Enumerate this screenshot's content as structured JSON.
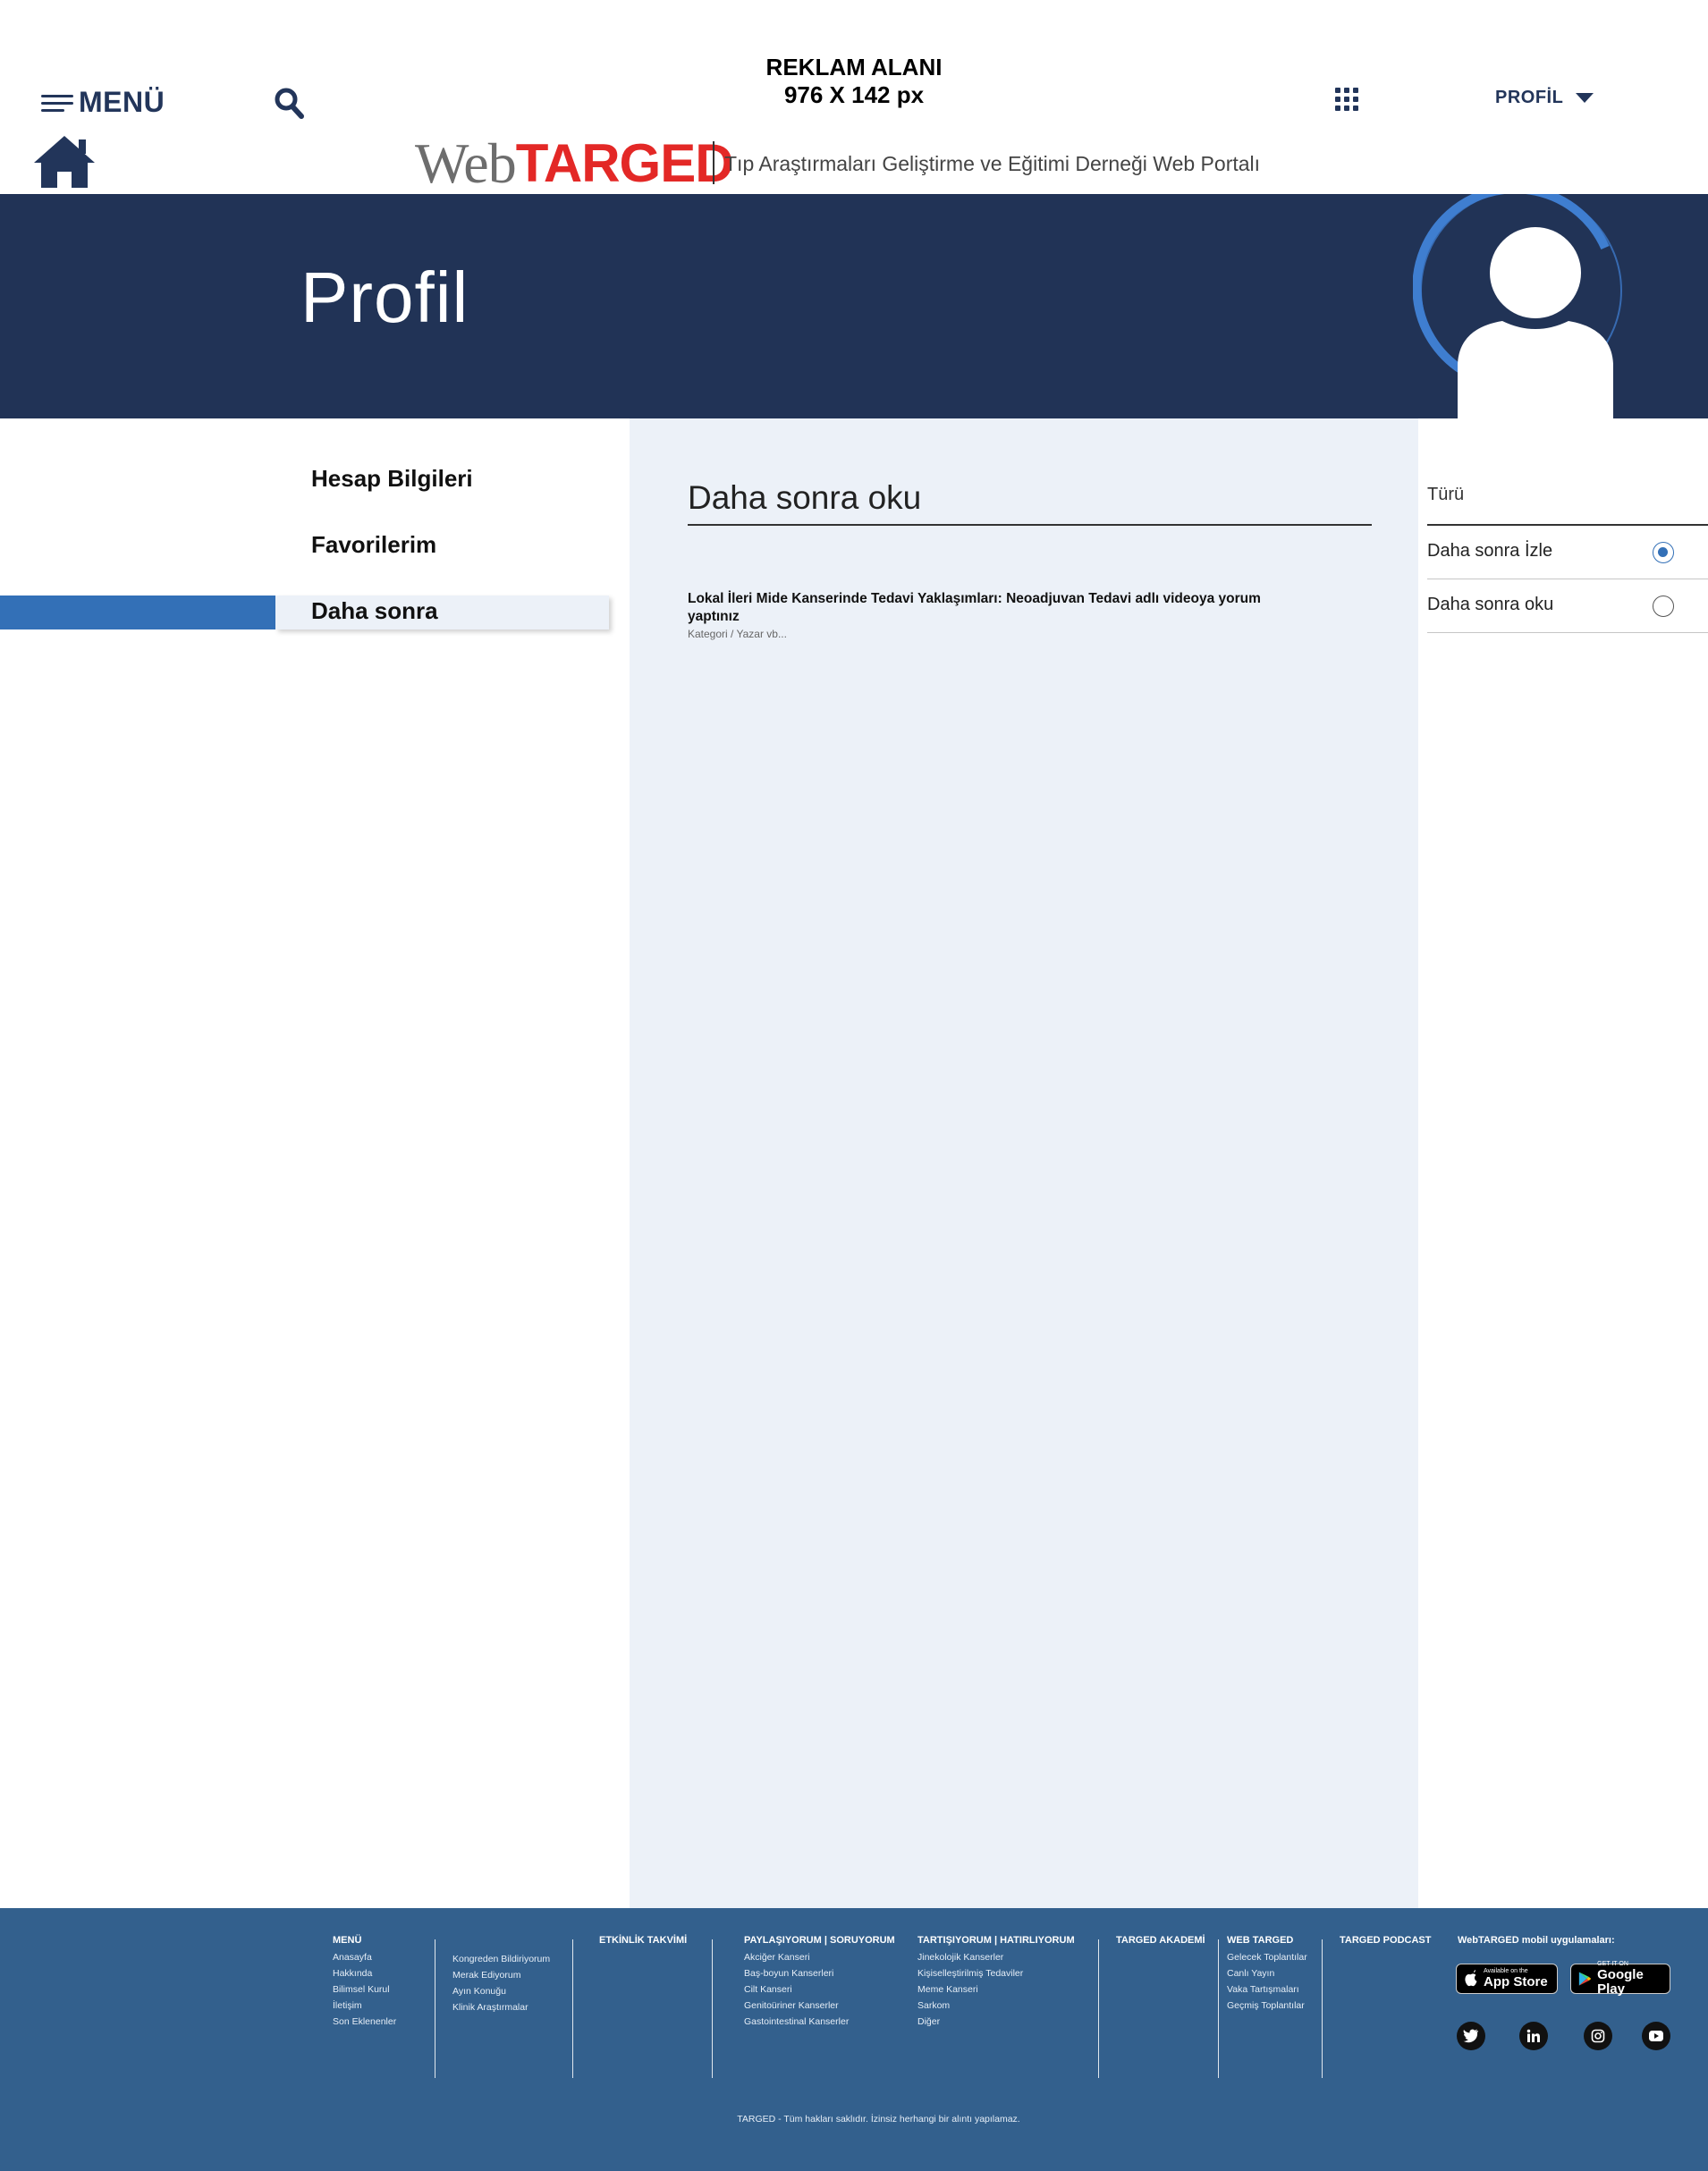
{
  "header": {
    "menu_label": "MENÜ",
    "ad_line1": "REKLAM ALANI",
    "ad_line2": "976 X 142 px",
    "profile_label": "PROFİL",
    "logo_web": "Web",
    "logo_targed": "TARGED",
    "tagline": "Tıp Araştırmaları Geliştirme ve Eğitimi Derneği Web Portalı"
  },
  "banner": {
    "title": "Profil"
  },
  "sidebar": {
    "items": [
      {
        "label": "Hesap Bilgileri"
      },
      {
        "label": "Favorilerim"
      },
      {
        "label": "Daha sonra",
        "active": true
      }
    ]
  },
  "main": {
    "title": "Daha sonra oku",
    "items": [
      {
        "title": "Lokal İleri Mide Kanserinde Tedavi Yaklaşımları: Neoadjuvan Tedavi adlı videoya yorum yaptınız",
        "meta": "Kategori / Yazar vb..."
      }
    ]
  },
  "filter": {
    "heading": "Türü",
    "options": [
      {
        "label": "Daha sonra İzle",
        "selected": true
      },
      {
        "label": "Daha sonra oku",
        "selected": false
      }
    ]
  },
  "footer": {
    "menu": {
      "heading": "MENÜ",
      "links": [
        "Anasayfa",
        "Hakkında",
        "Bilimsel Kurul",
        "İletişim",
        "Son Eklenenler"
      ]
    },
    "menu2": {
      "links": [
        "Kongreden Bildiriyorum",
        "Merak Ediyorum",
        "Ayın Konuğu",
        "Klinik Araştırmalar"
      ]
    },
    "events": {
      "heading": "ETKİNLİK TAKVİMİ"
    },
    "share": {
      "heading": "PAYLAŞIYORUM   |   SORUYORUM",
      "links": [
        "Akciğer Kanseri",
        "Baş-boyun Kanserleri",
        "Cilt Kanseri",
        "Genitoüriner Kanserler",
        "Gastointestinal Kanserler"
      ]
    },
    "discuss": {
      "heading": "TARTIŞIYORUM   |   HATIRLIYORUM",
      "links": [
        "Jinekolojik Kanserler",
        "Kişiselleştirilmiş Tedaviler",
        "Meme Kanseri",
        "Sarkom",
        "Diğer"
      ]
    },
    "academy": {
      "heading": "TARGED AKADEMİ"
    },
    "webtarged": {
      "heading": "WEB TARGED",
      "links": [
        "Gelecek Toplantılar",
        "Canlı Yayın",
        "Vaka Tartışmaları",
        "Geçmiş Toplantılar"
      ]
    },
    "podcast": {
      "heading": "TARGED PODCAST"
    },
    "apps": {
      "heading": "WebTARGED mobil uygulamaları:",
      "appstore_small": "Available on the",
      "appstore_big": "App Store",
      "googleplay_small": "GET IT ON",
      "googleplay_big": "Google Play"
    },
    "social_icons": [
      "twitter-icon",
      "linkedin-icon",
      "instagram-icon",
      "youtube-icon"
    ],
    "copyright": "TARGED - Tüm hakları saklıdır. İzinsiz herhangi bir alıntı yapılamaz."
  },
  "colors": {
    "navy": "#213356",
    "accent_blue": "#3370b7",
    "panel_bg": "#ecf1f8",
    "footer_bg": "#33608d",
    "logo_red": "#e32826"
  }
}
